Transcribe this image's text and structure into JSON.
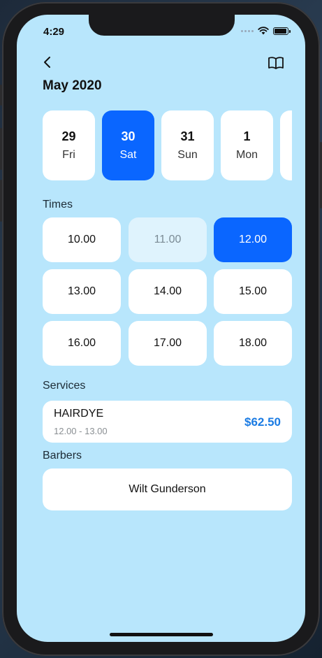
{
  "status_bar": {
    "time": "4:29"
  },
  "header": {
    "back_icon": "chevron-left-icon",
    "book_icon": "book-icon",
    "month_title": "May 2020"
  },
  "dates": [
    {
      "day": "29",
      "weekday": "Fri",
      "selected": false
    },
    {
      "day": "30",
      "weekday": "Sat",
      "selected": true
    },
    {
      "day": "31",
      "weekday": "Sun",
      "selected": false
    },
    {
      "day": "1",
      "weekday": "Mon",
      "selected": false
    },
    {
      "day": "",
      "weekday": "",
      "selected": false
    }
  ],
  "times": {
    "label": "Times",
    "slots": [
      {
        "label": "10.00",
        "state": "available"
      },
      {
        "label": "11.00",
        "state": "disabled"
      },
      {
        "label": "12.00",
        "state": "selected"
      },
      {
        "label": "13.00",
        "state": "available"
      },
      {
        "label": "14.00",
        "state": "available"
      },
      {
        "label": "15.00",
        "state": "available"
      },
      {
        "label": "16.00",
        "state": "available"
      },
      {
        "label": "17.00",
        "state": "available"
      },
      {
        "label": "18.00",
        "state": "available"
      }
    ]
  },
  "services": {
    "label": "Services",
    "item": {
      "name": "HAIRDYE",
      "time_range": "12.00 - 13.00",
      "price": "$62.50"
    }
  },
  "barbers": {
    "label": "Barbers",
    "selected_name": "Wilt Gunderson"
  },
  "colors": {
    "background": "#b8e6fc",
    "accent": "#0a66ff",
    "price": "#1a7be3"
  }
}
